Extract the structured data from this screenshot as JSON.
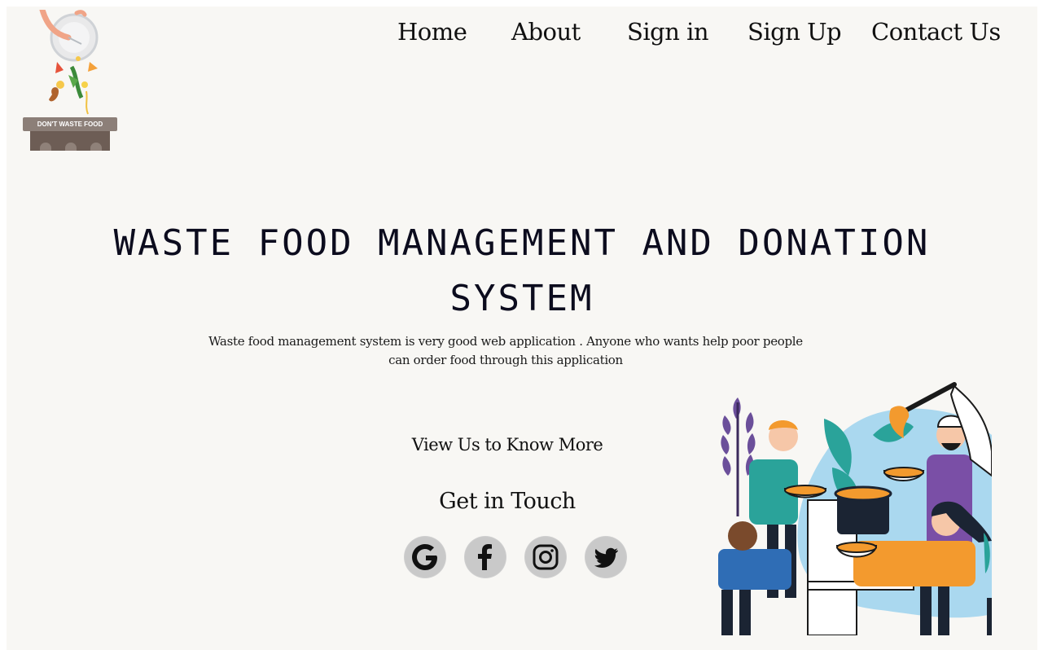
{
  "logo": {
    "sign_text": "DON'T WASTE FOOD"
  },
  "nav": {
    "items": [
      {
        "label": "Home"
      },
      {
        "label": "About"
      },
      {
        "label": "Sign in"
      },
      {
        "label": "Sign Up"
      },
      {
        "label": "Contact Us"
      }
    ]
  },
  "hero": {
    "title_line1": "WASTE FOOD MANAGEMENT AND DONATION",
    "title_line2": "SYSTEM",
    "description_line1": "Waste food management system is very good web application . Anyone who wants help poor people",
    "description_line2": "can order food through this application",
    "more_link": "View Us to Know More",
    "contact_heading": "Get in Touch"
  },
  "social": [
    {
      "icon": "google-icon"
    },
    {
      "icon": "facebook-icon"
    },
    {
      "icon": "instagram-icon"
    },
    {
      "icon": "twitter-icon"
    }
  ],
  "colors": {
    "background": "#f8f7f4",
    "title": "#0c0c1e",
    "social_circle": "#cfcfcf"
  }
}
